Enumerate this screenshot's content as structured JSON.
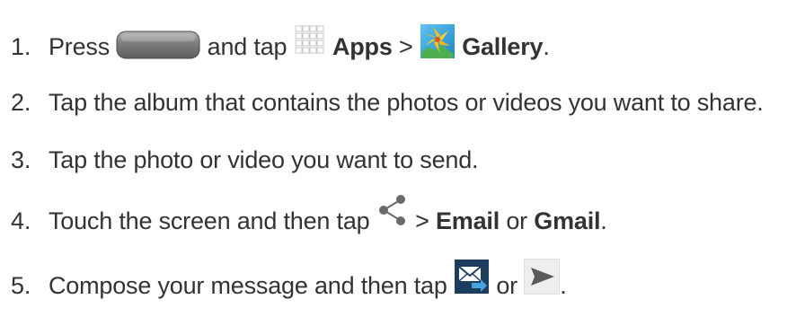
{
  "steps": [
    {
      "number": "1.",
      "text_a": "Press",
      "home_button_icon": "home-button",
      "text_b": "and tap",
      "apps_icon": "apps-grid-icon",
      "apps_label": "Apps",
      "sep": ">",
      "gallery_icon": "gallery-icon",
      "gallery_label": "Gallery",
      "end": "."
    },
    {
      "number": "2.",
      "text": "Tap the album that contains the photos or videos you want to share."
    },
    {
      "number": "3.",
      "text": "Tap the photo or video you want to send."
    },
    {
      "number": "4.",
      "text_a": "Touch the screen and then tap",
      "share_icon": "share-icon",
      "sep": ">",
      "email_label": "Email",
      "or": "or",
      "gmail_label": "Gmail",
      "end": "."
    },
    {
      "number": "5.",
      "text_a": "Compose your message and then tap",
      "send_email_icon": "send-email-icon",
      "or": "or",
      "send_icon": "send-arrow-icon",
      "end": "."
    }
  ],
  "colors": {
    "text": "#333333",
    "home_button": "#7a7a7a",
    "gallery_bg": "#3aa7e0",
    "flower": "#f4c21a",
    "send_email_bg": "#1d3d5e",
    "send_arrow": "#5a5a5a"
  }
}
